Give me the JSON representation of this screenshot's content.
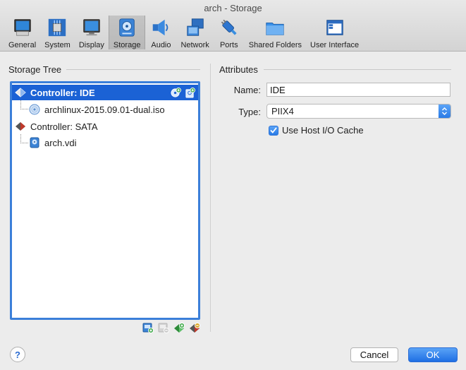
{
  "window": {
    "title": "arch - Storage"
  },
  "toolbar": {
    "items": [
      {
        "label": "General",
        "icon": "general-monitor-icon"
      },
      {
        "label": "System",
        "icon": "chip-icon"
      },
      {
        "label": "Display",
        "icon": "display-icon"
      },
      {
        "label": "Storage",
        "icon": "disk-icon",
        "selected": true
      },
      {
        "label": "Audio",
        "icon": "speaker-icon"
      },
      {
        "label": "Network",
        "icon": "network-icon"
      },
      {
        "label": "Ports",
        "icon": "port-plug-icon"
      },
      {
        "label": "Shared Folders",
        "icon": "folder-icon"
      },
      {
        "label": "User Interface",
        "icon": "window-icon"
      }
    ]
  },
  "storage_tree": {
    "title": "Storage Tree",
    "items": [
      {
        "label": "Controller: IDE",
        "type": "controller",
        "selected": true
      },
      {
        "label": "archlinux-2015.09.01-dual.iso",
        "type": "optical"
      },
      {
        "label": "Controller: SATA",
        "type": "controller"
      },
      {
        "label": "arch.vdi",
        "type": "hard-disk"
      }
    ]
  },
  "attributes": {
    "title": "Attributes",
    "name_label": "Name:",
    "name_value": "IDE",
    "type_label": "Type:",
    "type_value": "PIIX4",
    "host_cache_label": "Use Host I/O Cache",
    "host_cache_checked": true
  },
  "footer": {
    "help_label": "?",
    "cancel_label": "Cancel",
    "ok_label": "OK"
  },
  "colors": {
    "accent": "#1b62d5",
    "tree_border": "#3b7fd9"
  }
}
